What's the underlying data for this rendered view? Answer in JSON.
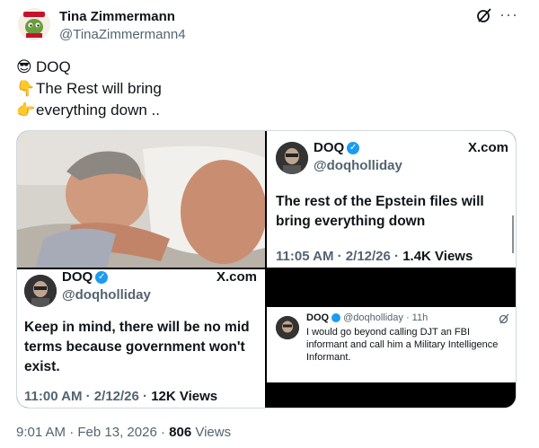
{
  "author": {
    "name": "Tina Zimmermann",
    "handle": "@TinaZimmermann4"
  },
  "post": {
    "lines": [
      {
        "emoji": "😎",
        "text": "DOQ"
      },
      {
        "emoji": "👇",
        "text": "The Rest will bring"
      },
      {
        "emoji": "👉",
        "text": "everything down .."
      }
    ],
    "time": "9:01 AM",
    "date": "Feb 13, 2026",
    "views_count": "806",
    "views_label": "Views"
  },
  "quote_top_right": {
    "name": "DOQ",
    "handle": "@doqholliday",
    "source": "X.com",
    "text": "The rest of the Epstein files will bring everything down",
    "meta": "11:05 AM · 2/12/26 · ",
    "views": "1.4K",
    "views_label": "Views"
  },
  "quote_bottom_left": {
    "name": "DOQ",
    "handle": "@doqholliday",
    "source": "X.com",
    "text": "Keep in mind, there will be no mid terms because government won't exist.",
    "meta": "11:00 AM · 2/12/26 · ",
    "views": "12K",
    "views_label": "Views"
  },
  "reply_card": {
    "name": "DOQ",
    "handle_time": "@doqholliday · 11h",
    "text": "I would go beyond calling DJT an FBI informant and call him a Military Intelligence Informant."
  },
  "icons": {
    "grok": "grok-icon",
    "more": "more-icon"
  },
  "colors": {
    "verified": "#1d9bf0",
    "muted": "#536471",
    "text": "#0f1419"
  }
}
